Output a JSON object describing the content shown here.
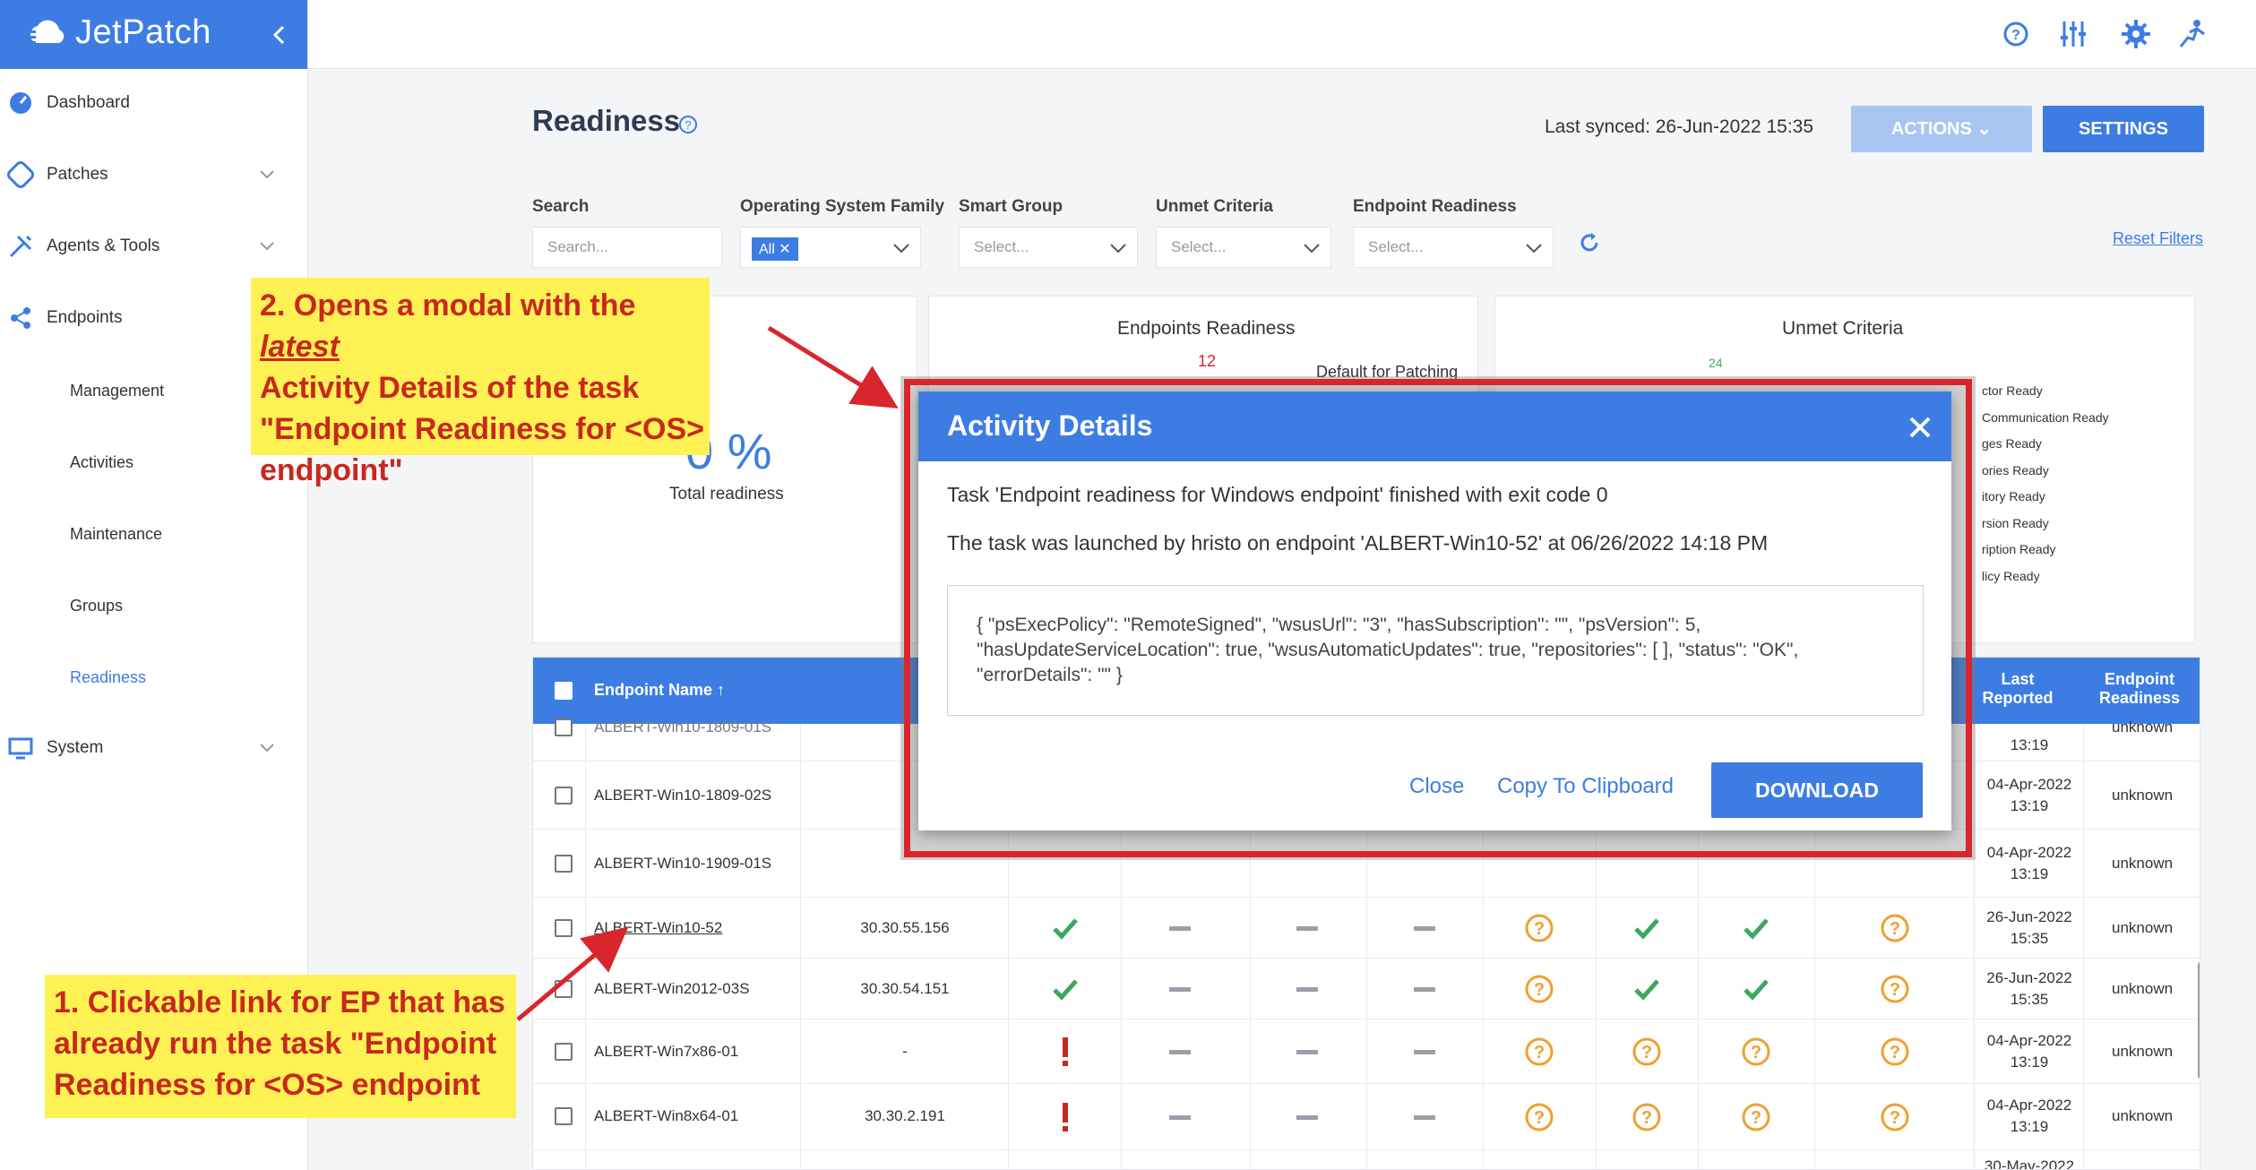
{
  "app": {
    "brand": "JetPatch"
  },
  "sidebar": {
    "items": [
      {
        "label": "Dashboard",
        "icon": "dashboard-icon"
      },
      {
        "label": "Patches",
        "icon": "patches-icon"
      },
      {
        "label": "Agents & Tools",
        "icon": "tools-icon"
      },
      {
        "label": "Endpoints",
        "icon": "endpoints-icon"
      },
      {
        "label": "System",
        "icon": "system-icon"
      }
    ],
    "sub_items": [
      "Management",
      "Activities",
      "Maintenance",
      "Groups",
      "Readiness"
    ]
  },
  "header": {
    "icons": [
      "help-icon",
      "sliders-icon",
      "gear-icon",
      "logout-icon"
    ]
  },
  "page": {
    "title": "Readiness",
    "last_synced": "Last synced: 26-Jun-2022 15:35",
    "actions_label": "ACTIONS",
    "settings_label": "SETTINGS",
    "reset_filters": "Reset Filters"
  },
  "filters": {
    "search_label": "Search",
    "search_placeholder": "Search...",
    "os_label": "Operating System Family",
    "os_chip": "All",
    "group_label": "Smart Group",
    "group_placeholder": "Select...",
    "criteria_label": "Unmet Criteria",
    "criteria_placeholder": "Select...",
    "readiness_label": "Endpoint Readiness",
    "readiness_placeholder": "Select..."
  },
  "cards": {
    "total_value": "0 %",
    "total_label": "Total readiness",
    "readiness_title": "Endpoints Readiness",
    "readiness_count": "12",
    "readiness_partial": "Default for Patching",
    "unmet_title": "Unmet Criteria",
    "unmet_count": "24",
    "unmet_legend": [
      "ctor Ready",
      "Communication Ready",
      "ges Ready",
      "ories Ready",
      "itory Ready",
      "rsion Ready",
      "ription Ready",
      "licy Ready"
    ]
  },
  "table": {
    "headers": {
      "name": "Endpoint Name",
      "last_reported": "Last Reported",
      "readiness": "Endpoint Readiness"
    },
    "rows": [
      {
        "name": "ALBERT-Win10-1809-01S",
        "ip": "",
        "reported_date": "",
        "reported_time": "13:19",
        "status": "unknown"
      },
      {
        "name": "ALBERT-Win10-1809-02S",
        "ip": "",
        "reported_date": "04-Apr-2022",
        "reported_time": "13:19",
        "status": "unknown"
      },
      {
        "name": "ALBERT-Win10-1909-01S",
        "ip": "",
        "reported_date": "04-Apr-2022",
        "reported_time": "13:19",
        "status": "unknown"
      },
      {
        "name": "ALBERT-Win10-52",
        "ip": "30.30.55.156",
        "reported_date": "26-Jun-2022",
        "reported_time": "15:35",
        "status": "unknown"
      },
      {
        "name": "ALBERT-Win2012-03S",
        "ip": "30.30.54.151",
        "reported_date": "26-Jun-2022",
        "reported_time": "15:35",
        "status": "unknown"
      },
      {
        "name": "ALBERT-Win7x86-01",
        "ip": "-",
        "reported_date": "04-Apr-2022",
        "reported_time": "13:19",
        "status": "unknown"
      },
      {
        "name": "ALBERT-Win8x64-01",
        "ip": "30.30.2.191",
        "reported_date": "04-Apr-2022",
        "reported_time": "13:19",
        "status": "unknown"
      },
      {
        "name": "",
        "ip": "",
        "reported_date": "30-May-2022",
        "reported_time": "",
        "status": ""
      }
    ]
  },
  "modal": {
    "title": "Activity Details",
    "line1": "Task 'Endpoint readiness for Windows endpoint' finished with exit code 0",
    "line2": "The task was launched by hristo on endpoint 'ALBERT-Win10-52' at 06/26/2022 14:18 PM",
    "json": "{ \"psExecPolicy\": \"RemoteSigned\", \"wsusUrl\": \"3\", \"hasSubscription\": \"\", \"psVersion\": 5, \"hasUpdateServiceLocation\": true, \"wsusAutomaticUpdates\": true, \"repositories\": [ ], \"status\": \"OK\", \"errorDetails\": \"\" }",
    "close_label": "Close",
    "copy_label": "Copy To Clipboard",
    "download_label": "DOWNLOAD"
  },
  "annotations": {
    "note2_pre": "2. Opens a modal with the ",
    "note2_em": "latest",
    "note2_post": "Activity Details of the task \"Endpoint Readiness for <OS> endpoint\"",
    "note1": "1. Clickable link for EP that has already run the task \"Endpoint Readiness for <OS> endpoint"
  },
  "colors": {
    "primary": "#3d7de3",
    "annotation_bg": "#fdf154",
    "annotation_text": "#c8281e",
    "highlight": "#d8262c",
    "check": "#3aa860",
    "warn": "#f0a030",
    "error": "#c8281e"
  }
}
